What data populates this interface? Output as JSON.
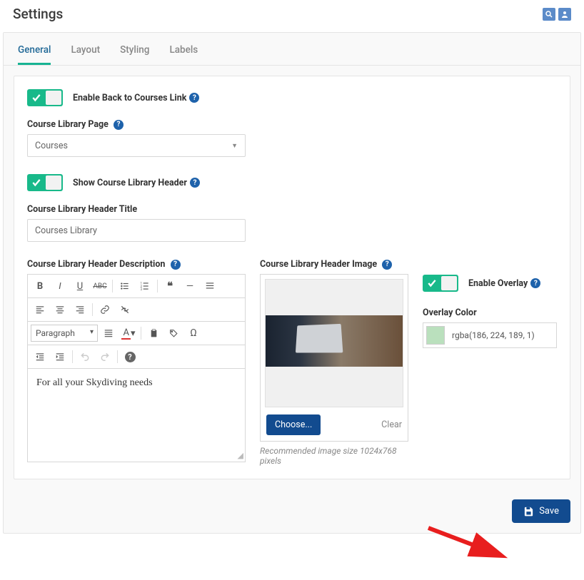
{
  "header": {
    "title": "Settings"
  },
  "tabs": [
    {
      "label": "General",
      "active": true
    },
    {
      "label": "Layout",
      "active": false
    },
    {
      "label": "Styling",
      "active": false
    },
    {
      "label": "Labels",
      "active": false
    }
  ],
  "general": {
    "enable_back_link": {
      "label": "Enable Back to Courses Link",
      "on": true
    },
    "course_library_page": {
      "label": "Course Library Page",
      "selected": "Courses"
    },
    "show_header": {
      "label": "Show Course Library Header",
      "on": true
    },
    "header_title": {
      "label": "Course Library Header Title",
      "value": "Courses Library"
    },
    "header_desc": {
      "label": "Course Library Header Description",
      "format_label": "Paragraph",
      "content": "For all your Skydiving needs"
    },
    "header_image": {
      "label": "Course Library Header Image",
      "choose": "Choose...",
      "clear": "Clear",
      "hint": "Recommended image size 1024x768 pixels"
    },
    "overlay": {
      "enable_label": "Enable Overlay",
      "on": true,
      "color_label": "Overlay Color",
      "color_value": "rgba(186, 224, 189, 1)"
    }
  },
  "footer": {
    "save": "Save"
  }
}
